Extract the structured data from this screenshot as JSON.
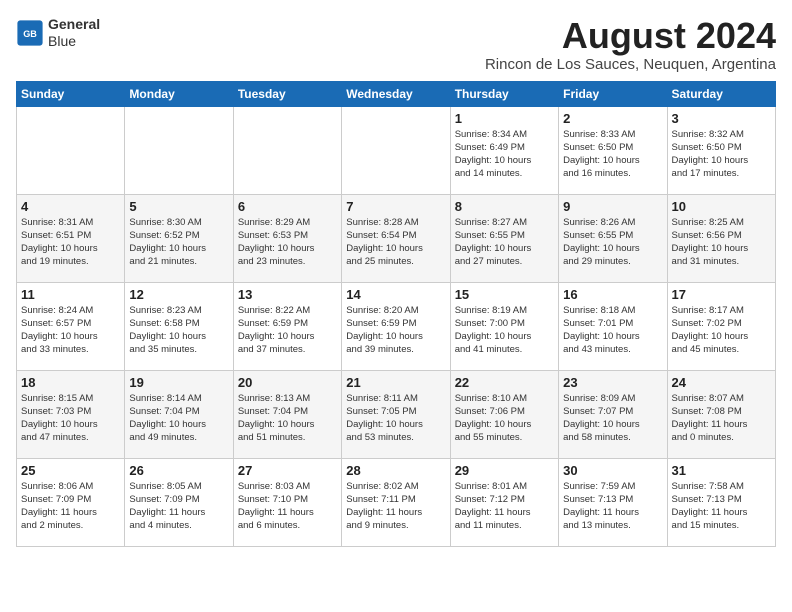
{
  "header": {
    "logo_line1": "General",
    "logo_line2": "Blue",
    "month_year": "August 2024",
    "location": "Rincon de Los Sauces, Neuquen, Argentina"
  },
  "days_of_week": [
    "Sunday",
    "Monday",
    "Tuesday",
    "Wednesday",
    "Thursday",
    "Friday",
    "Saturday"
  ],
  "weeks": [
    [
      {
        "day": "",
        "info": ""
      },
      {
        "day": "",
        "info": ""
      },
      {
        "day": "",
        "info": ""
      },
      {
        "day": "",
        "info": ""
      },
      {
        "day": "1",
        "info": "Sunrise: 8:34 AM\nSunset: 6:49 PM\nDaylight: 10 hours\nand 14 minutes."
      },
      {
        "day": "2",
        "info": "Sunrise: 8:33 AM\nSunset: 6:50 PM\nDaylight: 10 hours\nand 16 minutes."
      },
      {
        "day": "3",
        "info": "Sunrise: 8:32 AM\nSunset: 6:50 PM\nDaylight: 10 hours\nand 17 minutes."
      }
    ],
    [
      {
        "day": "4",
        "info": "Sunrise: 8:31 AM\nSunset: 6:51 PM\nDaylight: 10 hours\nand 19 minutes."
      },
      {
        "day": "5",
        "info": "Sunrise: 8:30 AM\nSunset: 6:52 PM\nDaylight: 10 hours\nand 21 minutes."
      },
      {
        "day": "6",
        "info": "Sunrise: 8:29 AM\nSunset: 6:53 PM\nDaylight: 10 hours\nand 23 minutes."
      },
      {
        "day": "7",
        "info": "Sunrise: 8:28 AM\nSunset: 6:54 PM\nDaylight: 10 hours\nand 25 minutes."
      },
      {
        "day": "8",
        "info": "Sunrise: 8:27 AM\nSunset: 6:55 PM\nDaylight: 10 hours\nand 27 minutes."
      },
      {
        "day": "9",
        "info": "Sunrise: 8:26 AM\nSunset: 6:55 PM\nDaylight: 10 hours\nand 29 minutes."
      },
      {
        "day": "10",
        "info": "Sunrise: 8:25 AM\nSunset: 6:56 PM\nDaylight: 10 hours\nand 31 minutes."
      }
    ],
    [
      {
        "day": "11",
        "info": "Sunrise: 8:24 AM\nSunset: 6:57 PM\nDaylight: 10 hours\nand 33 minutes."
      },
      {
        "day": "12",
        "info": "Sunrise: 8:23 AM\nSunset: 6:58 PM\nDaylight: 10 hours\nand 35 minutes."
      },
      {
        "day": "13",
        "info": "Sunrise: 8:22 AM\nSunset: 6:59 PM\nDaylight: 10 hours\nand 37 minutes."
      },
      {
        "day": "14",
        "info": "Sunrise: 8:20 AM\nSunset: 6:59 PM\nDaylight: 10 hours\nand 39 minutes."
      },
      {
        "day": "15",
        "info": "Sunrise: 8:19 AM\nSunset: 7:00 PM\nDaylight: 10 hours\nand 41 minutes."
      },
      {
        "day": "16",
        "info": "Sunrise: 8:18 AM\nSunset: 7:01 PM\nDaylight: 10 hours\nand 43 minutes."
      },
      {
        "day": "17",
        "info": "Sunrise: 8:17 AM\nSunset: 7:02 PM\nDaylight: 10 hours\nand 45 minutes."
      }
    ],
    [
      {
        "day": "18",
        "info": "Sunrise: 8:15 AM\nSunset: 7:03 PM\nDaylight: 10 hours\nand 47 minutes."
      },
      {
        "day": "19",
        "info": "Sunrise: 8:14 AM\nSunset: 7:04 PM\nDaylight: 10 hours\nand 49 minutes."
      },
      {
        "day": "20",
        "info": "Sunrise: 8:13 AM\nSunset: 7:04 PM\nDaylight: 10 hours\nand 51 minutes."
      },
      {
        "day": "21",
        "info": "Sunrise: 8:11 AM\nSunset: 7:05 PM\nDaylight: 10 hours\nand 53 minutes."
      },
      {
        "day": "22",
        "info": "Sunrise: 8:10 AM\nSunset: 7:06 PM\nDaylight: 10 hours\nand 55 minutes."
      },
      {
        "day": "23",
        "info": "Sunrise: 8:09 AM\nSunset: 7:07 PM\nDaylight: 10 hours\nand 58 minutes."
      },
      {
        "day": "24",
        "info": "Sunrise: 8:07 AM\nSunset: 7:08 PM\nDaylight: 11 hours\nand 0 minutes."
      }
    ],
    [
      {
        "day": "25",
        "info": "Sunrise: 8:06 AM\nSunset: 7:09 PM\nDaylight: 11 hours\nand 2 minutes."
      },
      {
        "day": "26",
        "info": "Sunrise: 8:05 AM\nSunset: 7:09 PM\nDaylight: 11 hours\nand 4 minutes."
      },
      {
        "day": "27",
        "info": "Sunrise: 8:03 AM\nSunset: 7:10 PM\nDaylight: 11 hours\nand 6 minutes."
      },
      {
        "day": "28",
        "info": "Sunrise: 8:02 AM\nSunset: 7:11 PM\nDaylight: 11 hours\nand 9 minutes."
      },
      {
        "day": "29",
        "info": "Sunrise: 8:01 AM\nSunset: 7:12 PM\nDaylight: 11 hours\nand 11 minutes."
      },
      {
        "day": "30",
        "info": "Sunrise: 7:59 AM\nSunset: 7:13 PM\nDaylight: 11 hours\nand 13 minutes."
      },
      {
        "day": "31",
        "info": "Sunrise: 7:58 AM\nSunset: 7:13 PM\nDaylight: 11 hours\nand 15 minutes."
      }
    ]
  ]
}
